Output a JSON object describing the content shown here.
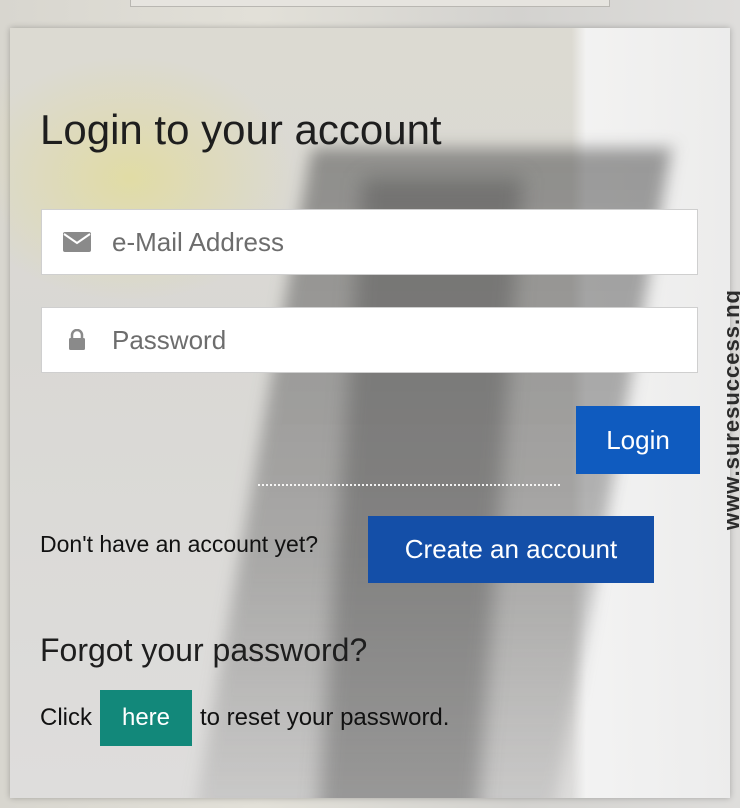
{
  "login": {
    "title": "Login to your account",
    "email_placeholder": "e-Mail Address",
    "password_placeholder": "Password",
    "login_button": "Login"
  },
  "signup": {
    "prompt": "Don't have an account yet?",
    "create_button": "Create an account"
  },
  "forgot": {
    "title": "Forgot your password?",
    "click_text": "Click",
    "here_button": "here",
    "reset_text": "to reset your password."
  },
  "watermark": "www.suresuccess.ng",
  "icons": {
    "email": "envelope-icon",
    "password": "lock-icon"
  },
  "colors": {
    "login_button": "#0f5bbf",
    "create_button": "#144fa8",
    "here_button": "#12887a"
  }
}
